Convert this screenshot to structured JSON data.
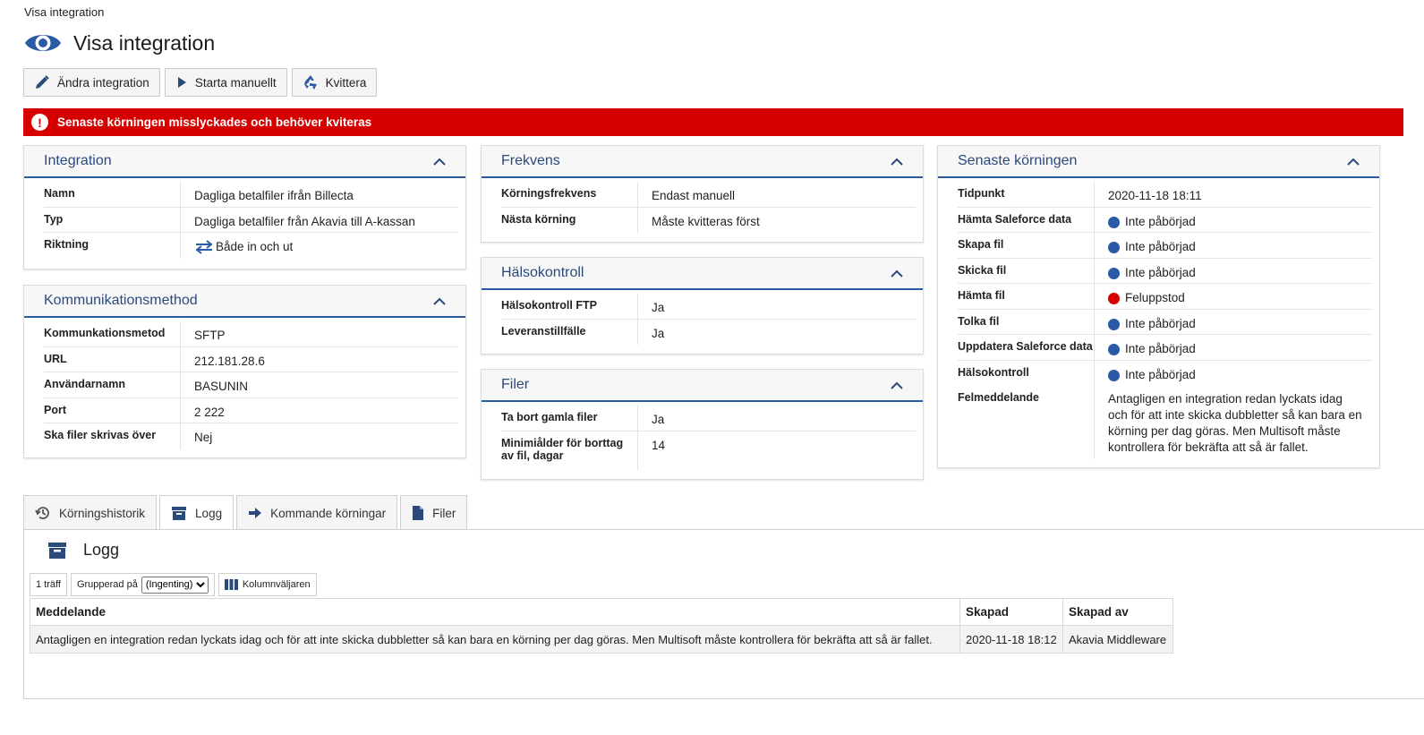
{
  "breadcrumb": "Visa integration",
  "page_title": "Visa integration",
  "toolbar": {
    "edit_label": "Ändra integration",
    "start_label": "Starta manuellt",
    "ack_label": "Kvittera"
  },
  "alert": {
    "text": "Senaste körningen misslyckades och behöver kviteras",
    "color": "#d60000"
  },
  "integration": {
    "title": "Integration",
    "rows": [
      {
        "key": "Namn",
        "value": "Dagliga betalfiler ifrån Billecta"
      },
      {
        "key": "Typ",
        "value": "Dagliga betalfiler från Akavia till A-kassan"
      },
      {
        "key": "Riktning",
        "value": "Både in och ut"
      }
    ]
  },
  "communication": {
    "title": "Kommunikationsmethod",
    "rows": [
      {
        "key": "Kommunkationsmetod",
        "value": "SFTP"
      },
      {
        "key": "URL",
        "value": "212.181.28.6"
      },
      {
        "key": "Användarnamn",
        "value": "BASUNIN"
      },
      {
        "key": "Port",
        "value": "2 222"
      },
      {
        "key": "Ska filer skrivas över",
        "value": "Nej"
      }
    ]
  },
  "frequency": {
    "title": "Frekvens",
    "rows": [
      {
        "key": "Körningsfrekvens",
        "value": "Endast manuell"
      },
      {
        "key": "Nästa körning",
        "value": "Måste kvitteras först"
      }
    ]
  },
  "health": {
    "title": "Hälsokontroll",
    "rows": [
      {
        "key": "Hälsokontroll FTP",
        "value": "Ja"
      },
      {
        "key": "Leveranstillfälle",
        "value": "Ja"
      }
    ]
  },
  "files": {
    "title": "Filer",
    "rows": [
      {
        "key": "Ta bort gamla filer",
        "value": "Ja"
      },
      {
        "key": "Minimiålder för borttag av fil, dagar",
        "value": "14"
      }
    ]
  },
  "last_run": {
    "title": "Senaste körningen",
    "time_key": "Tidpunkt",
    "time_value": "2020-11-18 18:11",
    "steps": [
      {
        "key": "Hämta Saleforce data",
        "value": "Inte påbörjad",
        "color": "#2b5aa5"
      },
      {
        "key": "Skapa fil",
        "value": "Inte påbörjad",
        "color": "#2b5aa5"
      },
      {
        "key": "Skicka fil",
        "value": "Inte påbörjad",
        "color": "#2b5aa5"
      },
      {
        "key": "Hämta fil",
        "value": "Feluppstod",
        "color": "#d60000"
      },
      {
        "key": "Tolka fil",
        "value": "Inte påbörjad",
        "color": "#2b5aa5"
      },
      {
        "key": "Uppdatera Saleforce data",
        "value": "Inte påbörjad",
        "color": "#2b5aa5"
      },
      {
        "key": "Hälsokontroll",
        "value": "Inte påbörjad",
        "color": "#2b5aa5"
      }
    ],
    "error_key": "Felmeddelande",
    "error_value": "Antagligen en integration redan lyckats idag och för att inte skicka dubbletter så kan bara en körning per dag göras. Men Multisoft måste kontrollera för bekräfta att så är fallet."
  },
  "tabs": [
    {
      "label": "Körningshistorik",
      "icon": "history-icon"
    },
    {
      "label": "Logg",
      "icon": "archive-icon",
      "active": true
    },
    {
      "label": "Kommande körningar",
      "icon": "arrow-right-icon"
    },
    {
      "label": "Filer",
      "icon": "file-icon"
    }
  ],
  "log": {
    "title": "Logg",
    "hits": "1 träff",
    "group_label": "Grupperad på",
    "group_value": "(Ingenting)",
    "columns_label": "Kolumnväljaren",
    "headers": [
      "Meddelande",
      "Skapad",
      "Skapad av"
    ],
    "rows": [
      [
        "Antagligen en integration redan lyckats idag och för att inte skicka dubbletter så kan bara en körning per dag göras. Men Multisoft måste kontrollera för bekräfta att så är fallet.",
        "2020-11-18 18:12",
        "Akavia Middleware"
      ]
    ]
  },
  "colors": {
    "accent": "#2b5aa5",
    "title_text": "#2b4a7c",
    "error": "#d60000"
  }
}
